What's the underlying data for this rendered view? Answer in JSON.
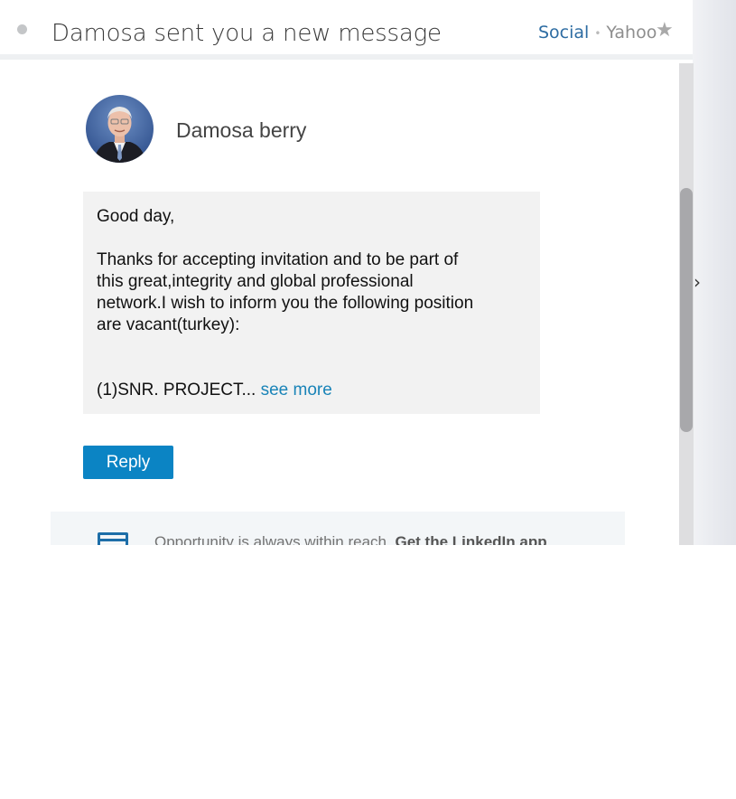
{
  "header": {
    "subject": "Damosa sent you a new message",
    "folder_social": "Social",
    "folder_separator": "•",
    "folder_yahoo": "Yahoo",
    "star_icon": "★"
  },
  "sidebar": {
    "expand_icon": "›"
  },
  "message": {
    "sender_name": "Damosa berry",
    "greeting": "Good day,",
    "body": "Thanks for accepting invitation and to be part of\nthis great,integrity and global professional\nnetwork.I wish to inform you the following position\nare vacant(turkey):",
    "excerpt": "(1)SNR. PROJECT...",
    "see_more": "see more",
    "reply_label": "Reply"
  },
  "footer": {
    "text": "Opportunity is always within reach.",
    "cta": "Get the LinkedIn app"
  },
  "colors": {
    "accent": "#0b84c4",
    "link": "#1a84b8",
    "folder_social": "#2d6ca2"
  }
}
